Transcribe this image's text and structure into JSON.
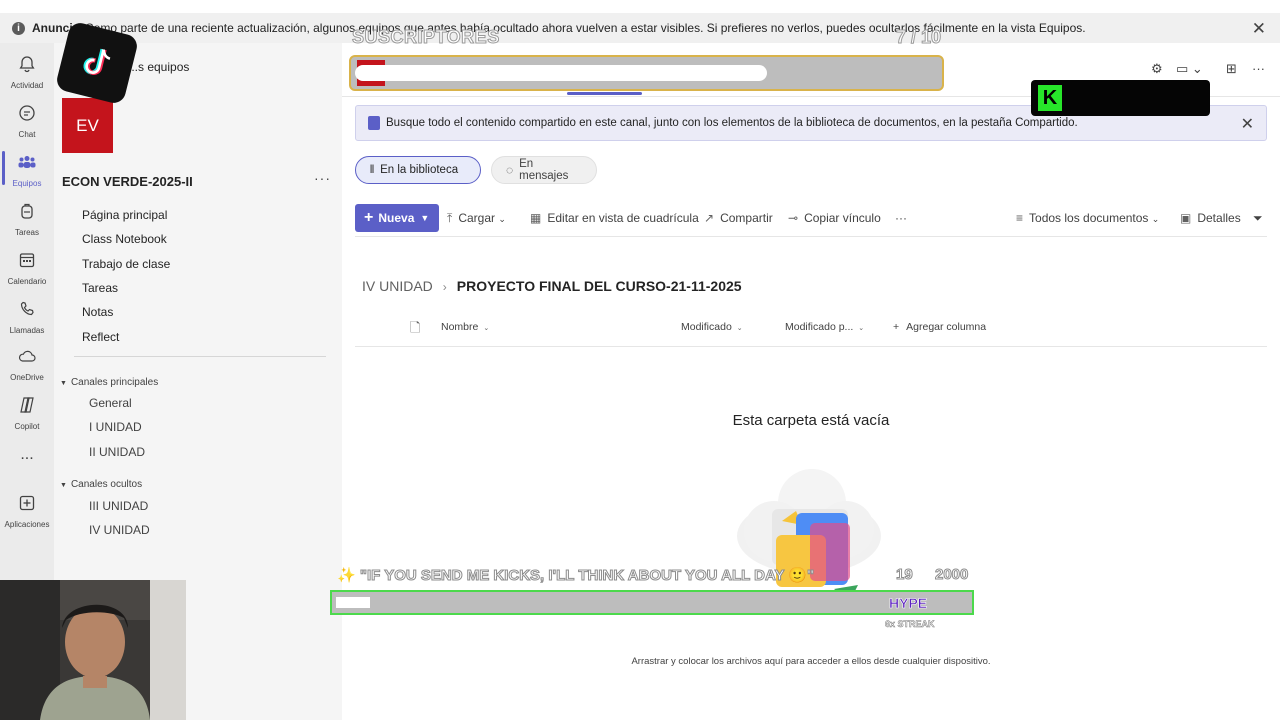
{
  "announcement": {
    "lead": "Anuncio",
    "text": "Como parte de una reciente actualización, algunos equipos que antes había ocultado ahora vuelven a estar visibles. Si prefieres no verlos, puedes ocultarlos fácilmente en la vista Equipos."
  },
  "rail": [
    {
      "label": "Actividad",
      "icon": "bell-icon"
    },
    {
      "label": "Chat",
      "icon": "chat-icon"
    },
    {
      "label": "Equipos",
      "icon": "teams-icon"
    },
    {
      "label": "Tareas",
      "icon": "backpack-icon"
    },
    {
      "label": "Calendario",
      "icon": "calendar-icon"
    },
    {
      "label": "Llamadas",
      "icon": "phone-icon"
    },
    {
      "label": "OneDrive",
      "icon": "cloud-icon"
    },
    {
      "label": "Copilot",
      "icon": "copilot-icon"
    },
    {
      "label": "...",
      "icon": "more-icon"
    },
    {
      "label": "Aplicaciones",
      "icon": "add-apps-icon"
    }
  ],
  "left_pane": {
    "back_label": "...s equipos",
    "avatar_initials": "EV",
    "team_name": "ECON VERDE-2025-II",
    "more": "···",
    "nav": [
      "Página principal",
      "Class Notebook",
      "Trabajo de clase",
      "Tareas",
      "Notas",
      "Reflect"
    ],
    "main_channels_header": "Canales principales",
    "main_channels": [
      "General",
      "I UNIDAD",
      "II UNIDAD"
    ],
    "hidden_channels_header": "Canales ocultos",
    "hidden_channels": [
      "III UNIDAD",
      "IV UNIDAD"
    ]
  },
  "banner": {
    "text": "Busque todo el contenido compartido en este canal, junto con los elementos de la biblioteca de documentos, en la pestaña Compartido."
  },
  "pills": {
    "library": "En la biblioteca",
    "messages": "En mensajes"
  },
  "command_bar": {
    "new": "Nueva",
    "upload": "Cargar",
    "grid_edit": "Editar en vista de cuadrícula",
    "share": "Compartir",
    "copy_link": "Copiar vínculo",
    "more": "···",
    "view": "Todos los documentos",
    "details": "Detalles"
  },
  "breadcrumb": {
    "parent": "IV UNIDAD",
    "current": "PROYECTO FINAL DEL CURSO-21-11-2025"
  },
  "columns": {
    "name": "Nombre",
    "modified": "Modificado",
    "modified_by": "Modificado p...",
    "add_column": "Agregar columna"
  },
  "empty_state": {
    "title": "Esta carpeta está vacía",
    "description": "Arrastrar y colocar los archivos aquí para acceder a ellos desde cualquier dispositivo."
  },
  "overlays": {
    "subs_label": "SUSCRIPTORES",
    "subs_count": "7 / 10",
    "kick_goal_text": "\"IF YOU SEND ME KICKS, I'LL THINK ABOUT YOU ALL DAY 🙂\"",
    "kick_current": "19",
    "kick_total": "2000",
    "hype": "HYPE",
    "streak": "6x STREAK",
    "kick_letter": "K"
  }
}
